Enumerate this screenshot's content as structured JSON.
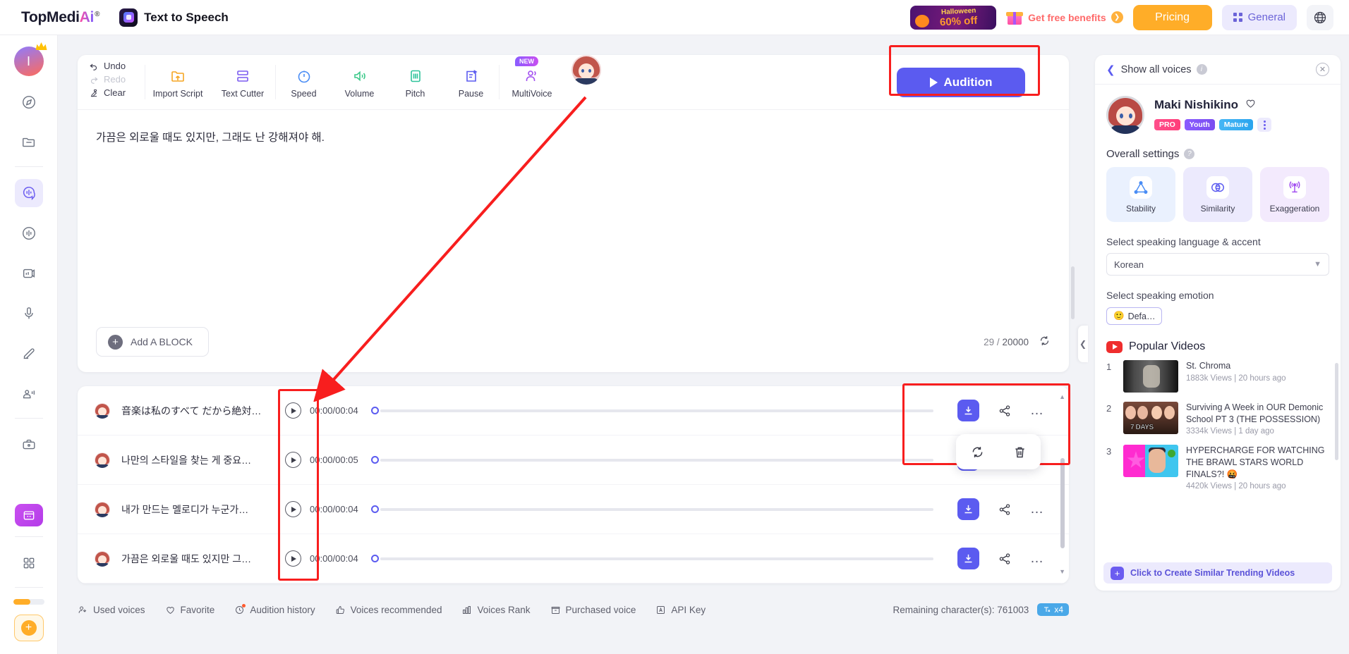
{
  "header": {
    "brand_prefix": "TopMedi",
    "brand_ai": "Ai",
    "brand_reg": "®",
    "app_name": "Text to Speech",
    "halloween_label": "Halloween",
    "halloween_off": "60% off",
    "benefits_label": "Get free benefits",
    "pricing_label": "Pricing",
    "general_label": "General",
    "globe_icon": "globe-icon"
  },
  "rail": {
    "avatar_initial": "I",
    "items": [
      {
        "name": "explore-icon"
      },
      {
        "name": "folder-icon"
      },
      {
        "name": "text-to-speech-icon",
        "active": true
      },
      {
        "name": "voice-changer-icon"
      },
      {
        "name": "video-translate-icon"
      },
      {
        "name": "microphone-icon"
      },
      {
        "name": "voice-clone-icon"
      },
      {
        "name": "avatar-icon"
      },
      {
        "name": "toolbox-icon"
      }
    ],
    "promo_icon": "calendar-promo-icon",
    "apps_icon": "apps-grid-icon",
    "add_icon": "add-icon"
  },
  "toolbar": {
    "undo": "Undo",
    "redo": "Redo",
    "clear": "Clear",
    "import_script": "Import Script",
    "text_cutter": "Text Cutter",
    "speed": "Speed",
    "volume": "Volume",
    "pitch": "Pitch",
    "pause": "Pause",
    "multivoice": "MultiVoice",
    "multivoice_badge": "NEW",
    "audition": "Audition"
  },
  "editor": {
    "text": "가끔은 외로울 때도 있지만, 그래도 난 강해져야 해.",
    "add_block": "Add A BLOCK",
    "char_current": "29",
    "char_separator": "/",
    "char_max": "20000",
    "refresh_icon": "refresh-icon"
  },
  "audio_list": {
    "rows": [
      {
        "title": "音楽は私のすべて だから絶対…",
        "time": "00:00/00:04",
        "progress": 0
      },
      {
        "title": "나만의 스타일을 찾는 게 중요…",
        "time": "00:00/00:05",
        "progress": 0
      },
      {
        "title": "내가 만드는 멜로디가 누군가…",
        "time": "00:00/00:04",
        "progress": 0
      },
      {
        "title": "가끔은 외로울 때도 있지만 그…",
        "time": "00:00/00:04",
        "progress": 0
      }
    ],
    "actions": {
      "download": "download-icon",
      "share": "share-icon",
      "more": "…"
    },
    "context_menu": {
      "regenerate": "regenerate-icon",
      "delete": "delete-icon"
    }
  },
  "bottom_bar": {
    "items": [
      {
        "label": "Used voices",
        "icon": "used-voices-icon"
      },
      {
        "label": "Favorite",
        "icon": "heart-icon"
      },
      {
        "label": "Audition history",
        "icon": "history-icon"
      },
      {
        "label": "Voices recommended",
        "icon": "thumbs-up-icon"
      },
      {
        "label": "Voices Rank",
        "icon": "rank-icon"
      },
      {
        "label": "Purchased voice",
        "icon": "purchased-icon"
      },
      {
        "label": "API Key",
        "icon": "api-key-icon"
      }
    ],
    "remaining": "Remaining character(s): 761003",
    "multiplier": "x4"
  },
  "right_panel": {
    "show_all_voices": "Show all voices",
    "close_icon": "close-icon",
    "voice_name": "Maki Nishikino",
    "favorite_icon": "heart-outline-icon",
    "tags": [
      "PRO",
      "Youth",
      "Mature"
    ],
    "overall_settings": "Overall settings",
    "settings": [
      {
        "label": "Stability",
        "icon": "stability-icon"
      },
      {
        "label": "Similarity",
        "icon": "similarity-icon"
      },
      {
        "label": "Exaggeration",
        "icon": "exaggeration-icon"
      }
    ],
    "language_label": "Select speaking language & accent",
    "language_value": "Korean",
    "emotion_label": "Select speaking emotion",
    "emotion_value": "Defa…",
    "emotion_emoji": "🙂",
    "popular_videos_title": "Popular Videos",
    "videos": [
      {
        "rank": "1",
        "title": "St. Chroma",
        "stats": "1883k Views | 20 hours ago"
      },
      {
        "rank": "2",
        "title": "Surviving A Week in OUR Demonic School PT 3 (THE POSSESSION)",
        "stats": "3334k Views | 1 day ago"
      },
      {
        "rank": "3",
        "title": "HYPERCHARGE FOR WATCHING THE BRAWL STARS WORLD FINALS?! 🤬",
        "stats": "4420k Views | 20 hours ago"
      }
    ],
    "create_similar": "Click to Create Similar Trending Videos"
  },
  "colors": {
    "accent": "#5b5bf0",
    "highlight": "#f81e1e",
    "pricing": "#ffad28"
  }
}
